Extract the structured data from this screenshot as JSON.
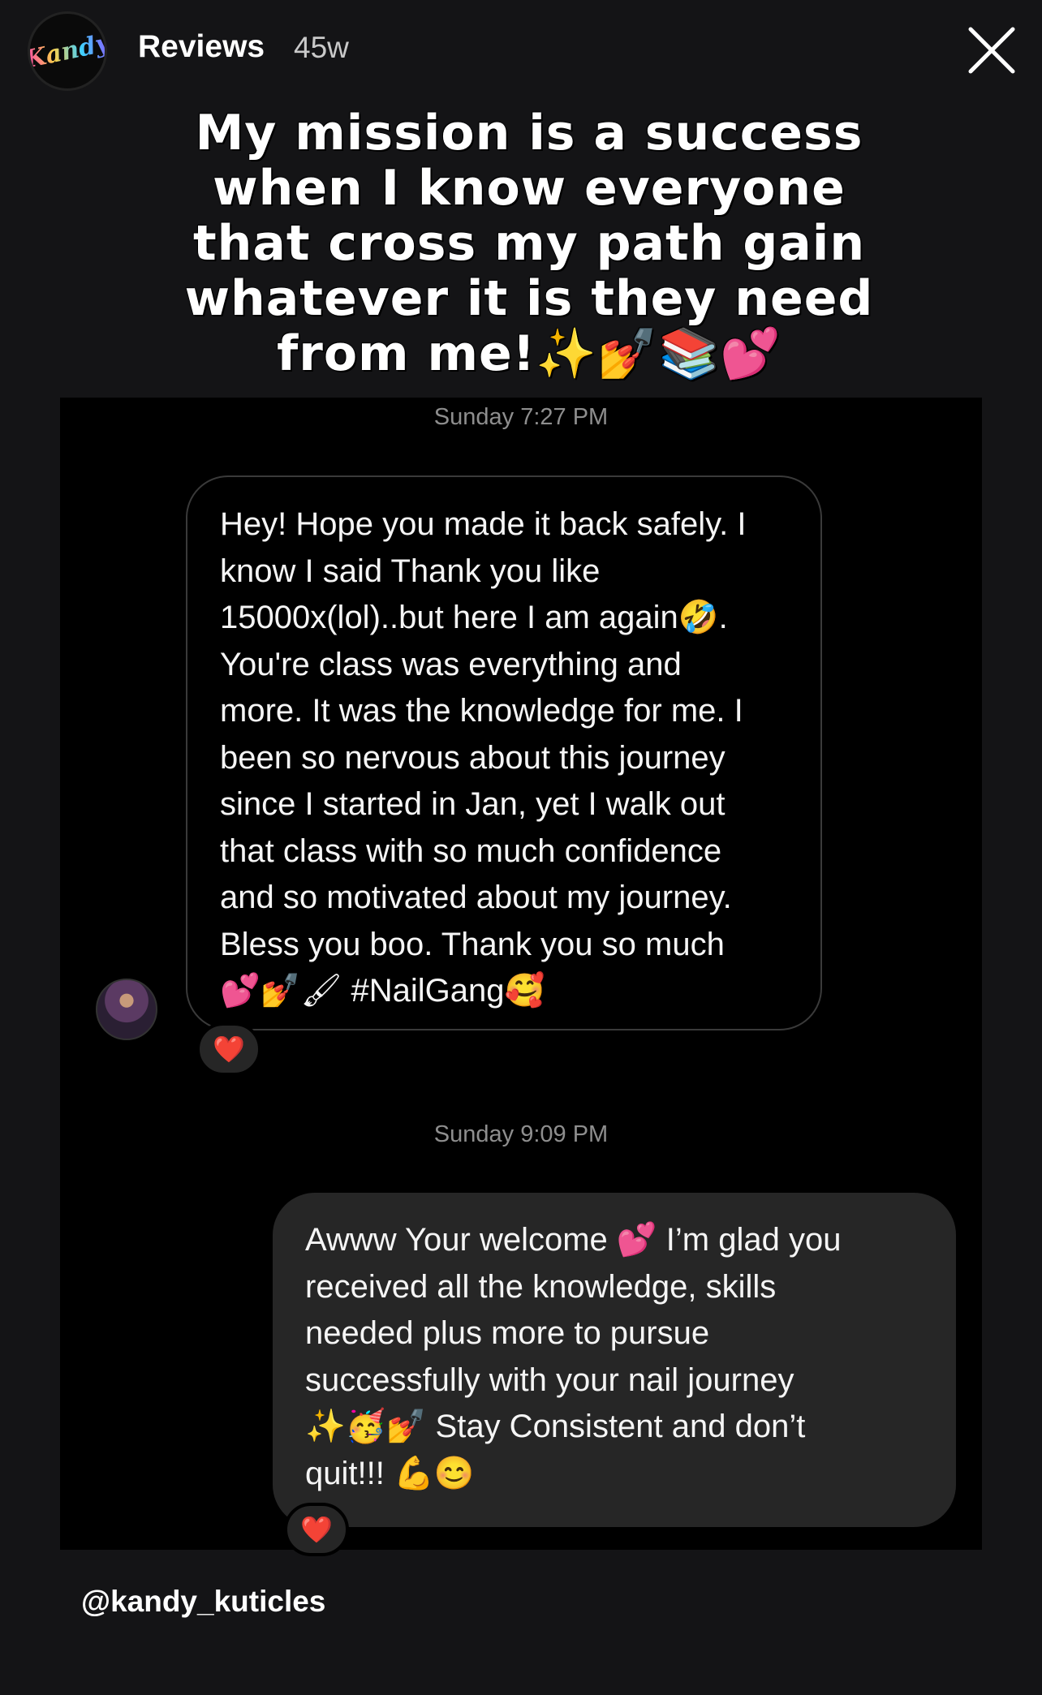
{
  "header": {
    "avatar_text": "Kandy",
    "title": "Reviews",
    "time": "45w",
    "close_icon": "close-icon"
  },
  "caption": {
    "lines": [
      "My mission is a success",
      "when I know everyone",
      "that cross my path gain",
      "whatever it is they need",
      "from me!✨💅📚💕"
    ]
  },
  "chat": {
    "timestamp_1": "Sunday 7:27 PM",
    "incoming_message": {
      "lines": [
        "Hey! Hope you made it back safely. I",
        "know I said Thank you like",
        "15000x(lol)..but here I am again🤣.",
        "You're class was everything and",
        "more. It was the knowledge for me. I",
        "been so nervous about this  journey",
        "since I started in Jan, yet I walk out",
        "that class with so much confidence",
        "and so motivated about my  journey.",
        "Bless you boo. Thank you so much",
        "💕💅🖌 #NailGang🥰"
      ],
      "reaction": "❤️"
    },
    "timestamp_2": "Sunday 9:09 PM",
    "outgoing_message": {
      "lines": [
        "Awww Your welcome 💕 I’m glad you",
        "received all the knowledge, skills",
        "needed plus more to pursue",
        "successfully with your nail journey",
        "✨🥳💅 Stay Consistent and don’t",
        "quit!!! 💪😊"
      ],
      "reaction": "❤️"
    }
  },
  "footer": {
    "handle": "@kandy_kuticles"
  },
  "colors": {
    "background": "#141416",
    "chat_background": "#000000",
    "outgoing_bubble": "#262626",
    "reaction_heart": "#ff2d55"
  }
}
